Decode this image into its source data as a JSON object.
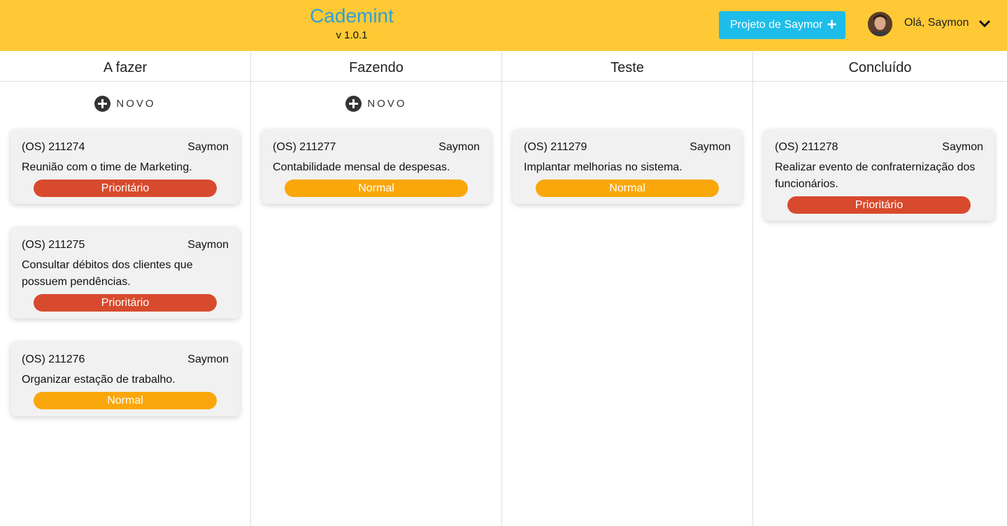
{
  "header": {
    "app_title": "Cademint",
    "version": "v 1.0.1",
    "project_button_label": "Projeto de Saymor",
    "project_button_icon": "plus-icon",
    "greeting": "Olá, Saymon",
    "user_menu_icon": "chevron-down-icon",
    "background": "#fec935"
  },
  "board": {
    "new_label": "NOVO",
    "columns": [
      {
        "title": "A fazer",
        "show_new": true,
        "cards": [
          {
            "id": "(OS) 211274",
            "assignee": "Saymon",
            "description": "Reunião com o time de Marketing.",
            "priority": "Prioritário",
            "priority_level": "high"
          },
          {
            "id": "(OS) 211275",
            "assignee": "Saymon",
            "description": "Consultar débitos dos clientes que possuem pendências.",
            "priority": "Prioritário",
            "priority_level": "high"
          },
          {
            "id": "(OS) 211276",
            "assignee": "Saymon",
            "description": "Organizar estação de trabalho.",
            "priority": "Normal",
            "priority_level": "normal"
          }
        ]
      },
      {
        "title": "Fazendo",
        "show_new": true,
        "cards": [
          {
            "id": "(OS) 211277",
            "assignee": "Saymon",
            "description": "Contabilidade mensal de despesas.",
            "priority": "Normal",
            "priority_level": "normal"
          }
        ]
      },
      {
        "title": "Teste",
        "show_new": false,
        "cards": [
          {
            "id": "(OS) 211279",
            "assignee": "Saymon",
            "description": "Implantar melhorias no sistema.",
            "priority": "Normal",
            "priority_level": "normal"
          }
        ]
      },
      {
        "title": "Concluído",
        "show_new": false,
        "cards": [
          {
            "id": "(OS) 211278",
            "assignee": "Saymon",
            "description": "Realizar evento de confraternização dos funcionários.",
            "priority": "Prioritário",
            "priority_level": "high"
          }
        ]
      }
    ]
  },
  "colors": {
    "brand_title": "#2f9fd8",
    "project_button": "#1ebde9",
    "priority_high": "#d84a2d",
    "priority_normal": "#faa70c"
  }
}
